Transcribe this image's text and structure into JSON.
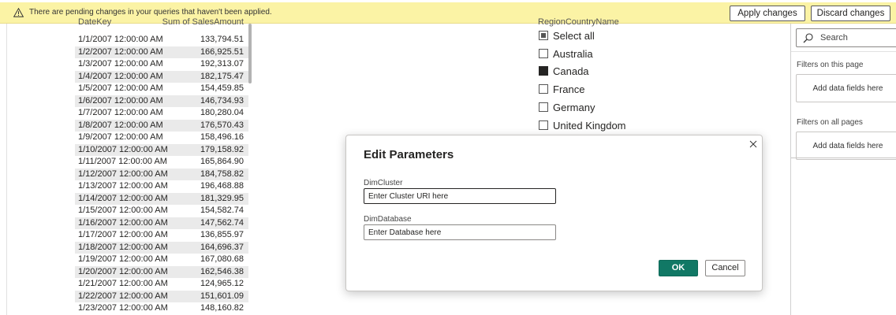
{
  "banner": {
    "message": "There are pending changes in your queries that haven't been applied.",
    "apply_label": "Apply changes",
    "discard_label": "Discard changes"
  },
  "table": {
    "columns": [
      "DateKey",
      "Sum of SalesAmount"
    ],
    "rows": [
      [
        "1/1/2007 12:00:00 AM",
        "133,794.51"
      ],
      [
        "1/2/2007 12:00:00 AM",
        "166,925.51"
      ],
      [
        "1/3/2007 12:00:00 AM",
        "192,313.07"
      ],
      [
        "1/4/2007 12:00:00 AM",
        "182,175.47"
      ],
      [
        "1/5/2007 12:00:00 AM",
        "154,459.85"
      ],
      [
        "1/6/2007 12:00:00 AM",
        "146,734.93"
      ],
      [
        "1/7/2007 12:00:00 AM",
        "180,280.04"
      ],
      [
        "1/8/2007 12:00:00 AM",
        "176,570.43"
      ],
      [
        "1/9/2007 12:00:00 AM",
        "158,496.16"
      ],
      [
        "1/10/2007 12:00:00 AM",
        "179,158.92"
      ],
      [
        "1/11/2007 12:00:00 AM",
        "165,864.90"
      ],
      [
        "1/12/2007 12:00:00 AM",
        "184,758.82"
      ],
      [
        "1/13/2007 12:00:00 AM",
        "196,468.88"
      ],
      [
        "1/14/2007 12:00:00 AM",
        "181,329.95"
      ],
      [
        "1/15/2007 12:00:00 AM",
        "154,582.74"
      ],
      [
        "1/16/2007 12:00:00 AM",
        "147,562.74"
      ],
      [
        "1/17/2007 12:00:00 AM",
        "136,855.97"
      ],
      [
        "1/18/2007 12:00:00 AM",
        "164,696.37"
      ],
      [
        "1/19/2007 12:00:00 AM",
        "167,080.68"
      ],
      [
        "1/20/2007 12:00:00 AM",
        "162,546.38"
      ],
      [
        "1/21/2007 12:00:00 AM",
        "124,965.12"
      ],
      [
        "1/22/2007 12:00:00 AM",
        "151,601.09"
      ],
      [
        "1/23/2007 12:00:00 AM",
        "148,160.82"
      ]
    ]
  },
  "slicer": {
    "title": "RegionCountryName",
    "items": [
      {
        "label": "Select all",
        "state": "partial"
      },
      {
        "label": "Australia",
        "state": "unchecked"
      },
      {
        "label": "Canada",
        "state": "checked"
      },
      {
        "label": "France",
        "state": "unchecked"
      },
      {
        "label": "Germany",
        "state": "unchecked"
      },
      {
        "label": "United Kingdom",
        "state": "unchecked"
      }
    ]
  },
  "filters_pane": {
    "search_label": "Search",
    "on_this_page_label": "Filters on this page",
    "on_this_page_box": "Add data fields here",
    "on_all_pages_label": "Filters on all pages",
    "on_all_pages_box": "Add data fields here"
  },
  "modal": {
    "title": "Edit Parameters",
    "fields": [
      {
        "label": "DimCluster",
        "placeholder": "Enter Cluster URI here"
      },
      {
        "label": "DimDatabase",
        "placeholder": "Enter Database here"
      }
    ],
    "ok_label": "OK",
    "cancel_label": "Cancel"
  },
  "colors": {
    "banner_bg": "#fbf3a5",
    "primary_button": "#117865"
  },
  "icons": {
    "banner": "warning-icon",
    "search": "search-icon",
    "close": "close-icon"
  }
}
